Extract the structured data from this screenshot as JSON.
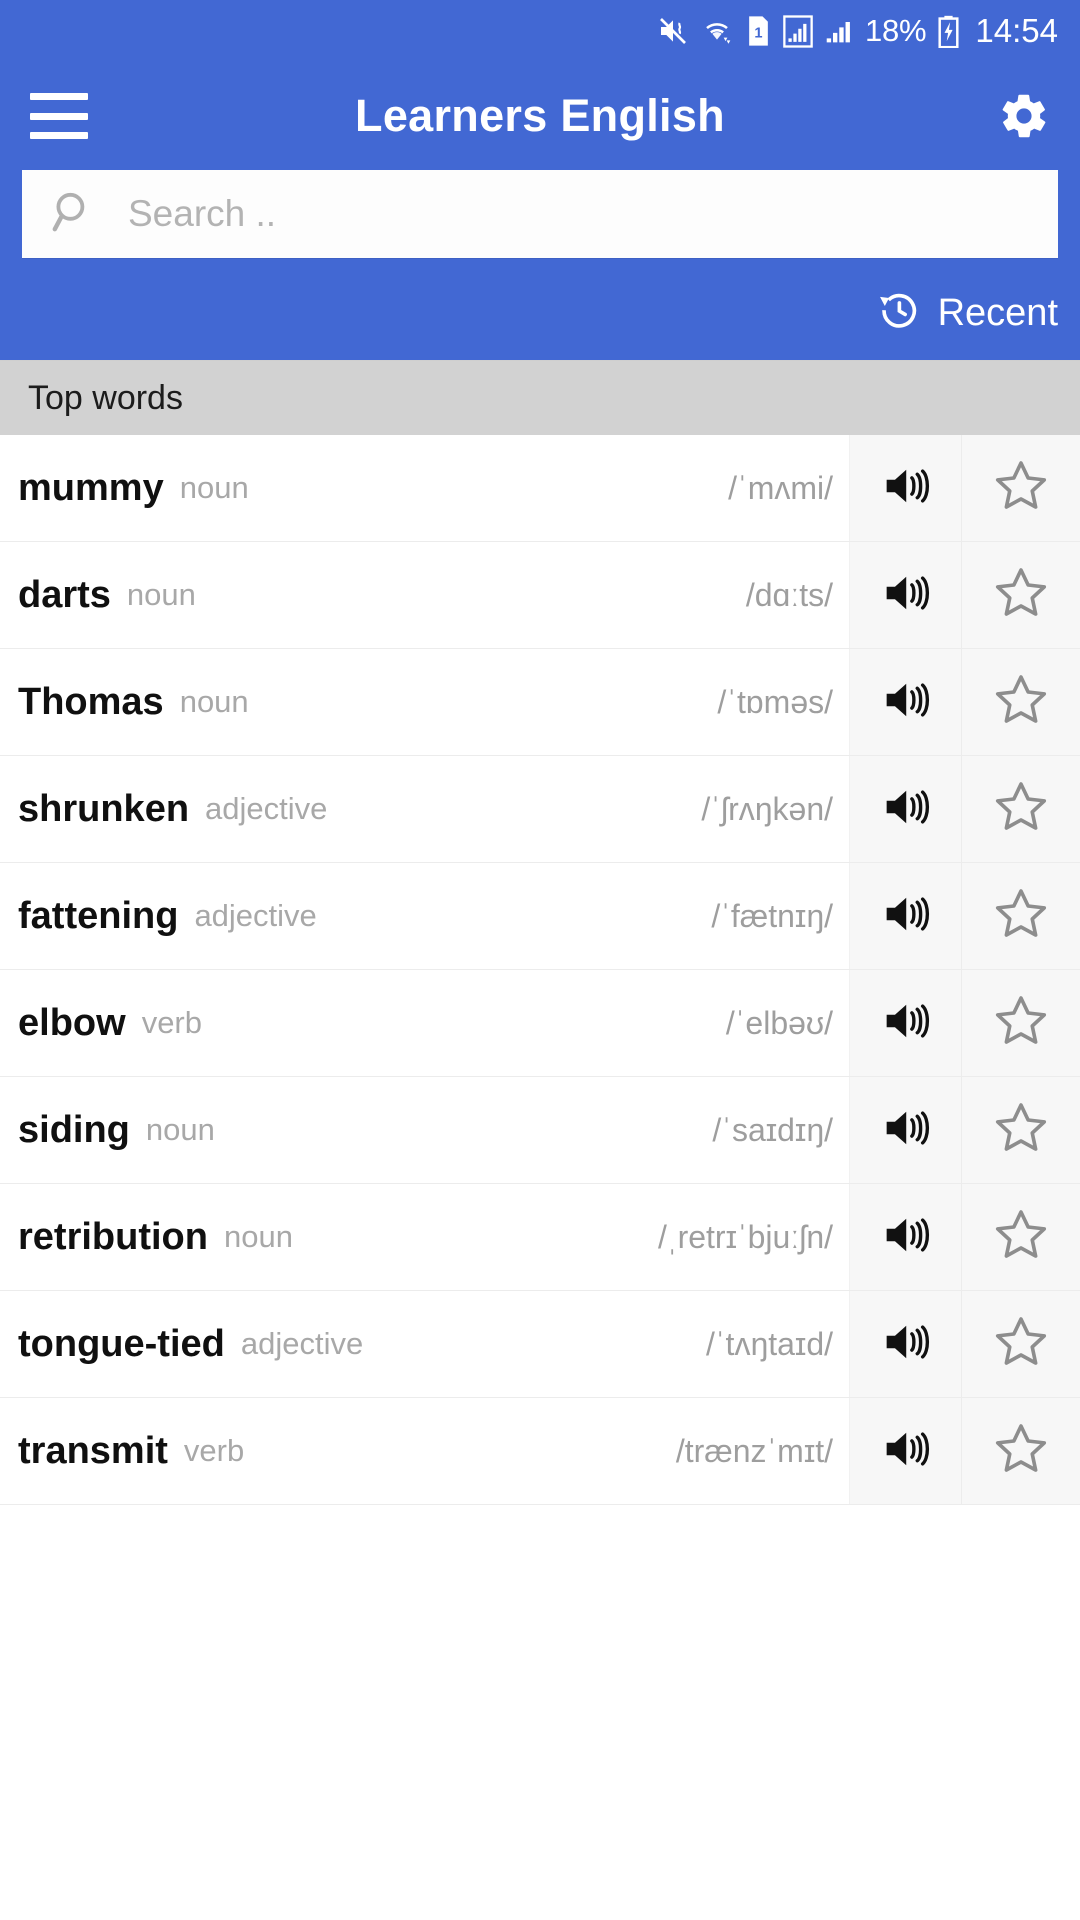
{
  "status_bar": {
    "icons": [
      "mute-vibrate-icon",
      "wifi-icon",
      "sim-1-icon",
      "signal-boxed-icon",
      "signal-bars-icon"
    ],
    "sim_label": "1",
    "battery_percent": "18%",
    "time": "14:54"
  },
  "app_bar": {
    "title": "Learners English",
    "menu_icon": "hamburger-menu-icon",
    "settings_icon": "gear-icon"
  },
  "search": {
    "placeholder": "Search ..",
    "value": "",
    "icon": "search-icon"
  },
  "recent": {
    "label": "Recent",
    "icon": "history-icon"
  },
  "section": {
    "title": "Top words"
  },
  "colors": {
    "brand_blue": "#4268d3",
    "section_grey": "#d2d2d2",
    "action_cell": "#f7f7f7"
  },
  "row_icons": {
    "audio": "speaker-icon",
    "favorite": "star-outline-icon"
  },
  "words": [
    {
      "word": "mummy",
      "pos": "noun",
      "ipa": "/ˈmʌmi/"
    },
    {
      "word": "darts",
      "pos": "noun",
      "ipa": "/dɑːts/"
    },
    {
      "word": "Thomas",
      "pos": "noun",
      "ipa": "/ˈtɒməs/"
    },
    {
      "word": "shrunken",
      "pos": "adjective",
      "ipa": "/ˈʃrʌŋkən/"
    },
    {
      "word": "fattening",
      "pos": "adjective",
      "ipa": "/ˈfætnɪŋ/"
    },
    {
      "word": "elbow",
      "pos": "verb",
      "ipa": "/ˈelbəʊ/"
    },
    {
      "word": "siding",
      "pos": "noun",
      "ipa": "/ˈsaɪdɪŋ/"
    },
    {
      "word": "retribution",
      "pos": "noun",
      "ipa": "/ˌretrɪˈbjuːʃn/"
    },
    {
      "word": "tongue-tied",
      "pos": "adjective",
      "ipa": "/ˈtʌŋtaɪd/"
    },
    {
      "word": "transmit",
      "pos": "verb",
      "ipa": "/trænzˈmɪt/"
    }
  ]
}
